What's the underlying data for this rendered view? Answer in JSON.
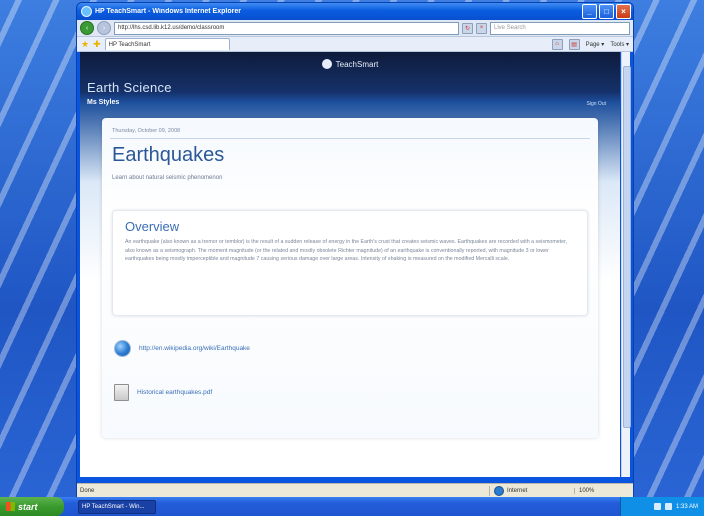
{
  "window": {
    "title": "HP TeachSmart - Windows Internet Explorer",
    "address": "http://lhs.csd.lib.k12.us/demo/classroom",
    "search_placeholder": "Live Search",
    "tab_label": "HP TeachSmart",
    "tools": [
      "Page ▾",
      "Tools ▾"
    ]
  },
  "site": {
    "brand": "TeachSmart",
    "class_title": "Earth Science",
    "section": "Ms Styles",
    "sign_out": "Sign Out"
  },
  "lesson": {
    "date": "Thursday, October 09, 2008",
    "title": "Earthquakes",
    "subtitle": "Learn about natural seismic phenomenon",
    "overview_heading": "Overview",
    "overview_body": "An earthquake (also known as a tremor or temblor) is the result of a sudden release of energy in the Earth's crust that creates seismic waves. Earthquakes are recorded with a seismometer, also known as a seismograph. The moment magnitude (or the related and mostly obsolete Richter magnitude) of an earthquake is conventionally reported, with magnitude 3 or lower earthquakes being mostly imperceptible and magnitude 7 causing serious damage over large areas. Intensity of shaking is measured on the modified Mercalli scale."
  },
  "resources": [
    {
      "label": "http://en.wikipedia.org/wiki/Earthquake",
      "icon": "globe-icon"
    },
    {
      "label": "Historical earthquakes.pdf",
      "icon": "document-icon"
    }
  ],
  "status": {
    "left": "Done",
    "zone": "Internet",
    "zoom": "100%"
  },
  "taskbar": {
    "start": "start",
    "task": "HP TeachSmart - Win...",
    "clock": "1:33 AM"
  }
}
